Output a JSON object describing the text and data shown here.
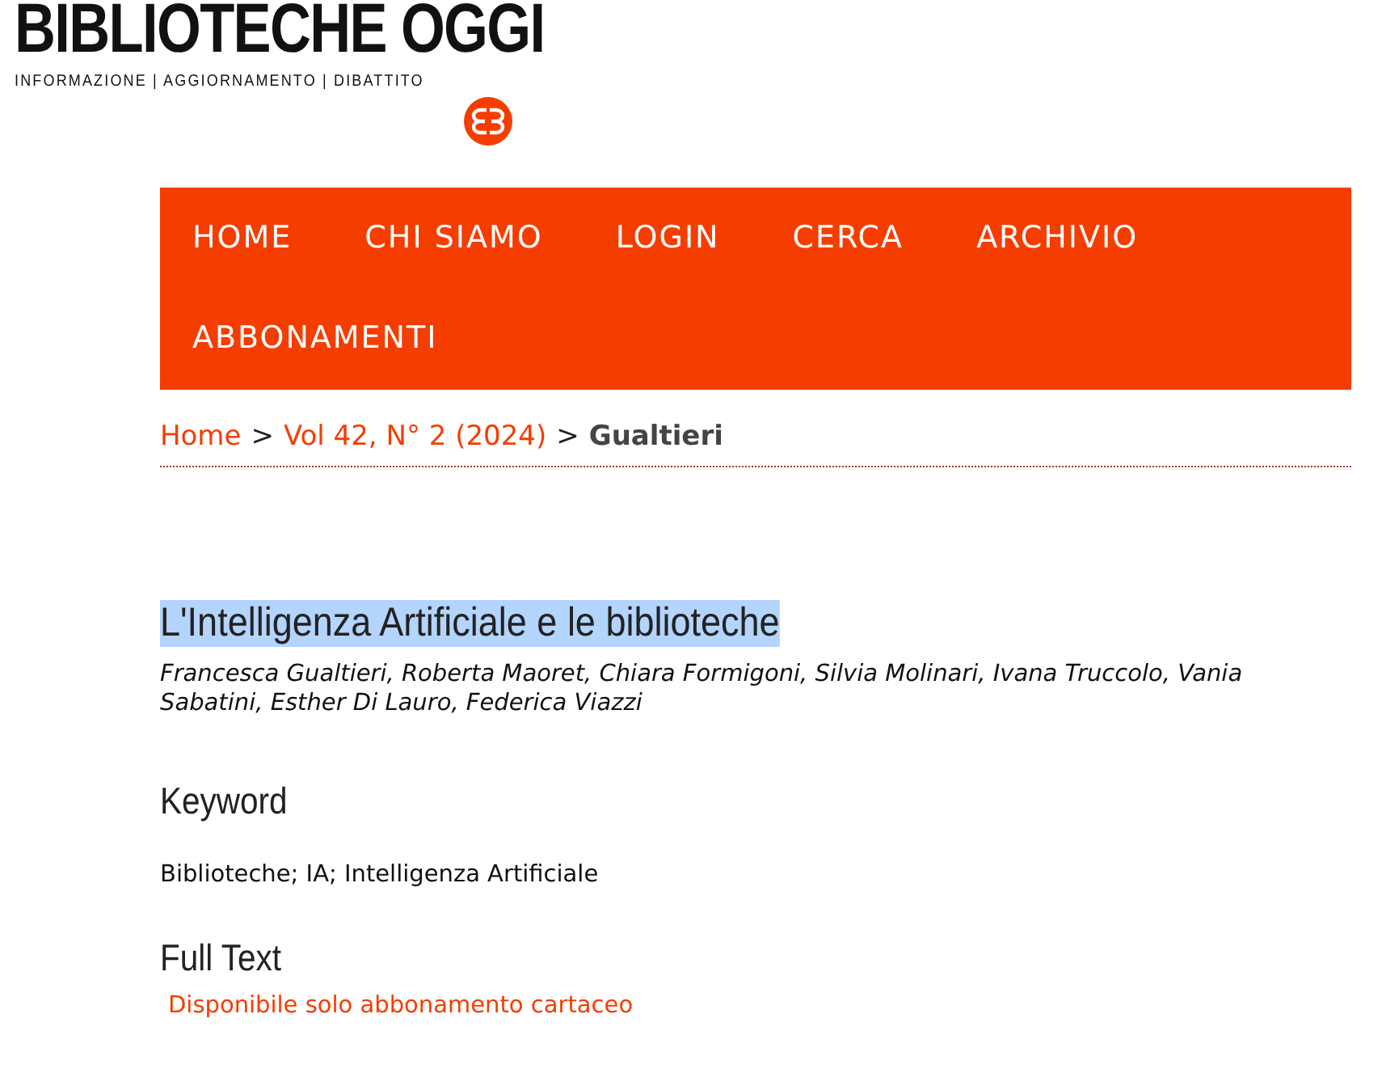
{
  "header": {
    "title": "BIBLIOTECHE OGGI",
    "tagline": "INFORMAZIONE | AGGIORNAMENTO | DIBATTITO"
  },
  "nav": [
    "HOME",
    "CHI SIAMO",
    "LOGIN",
    "CERCA",
    "ARCHIVIO",
    "ABBONAMENTI"
  ],
  "breadcrumb": {
    "links": [
      "Home",
      "Vol 42, N° 2 (2024)"
    ],
    "separator": ">",
    "current": "Gualtieri"
  },
  "article": {
    "title": "L'Intelligenza Artificiale e le biblioteche",
    "title_selected": true,
    "authors": "Francesca Gualtieri, Roberta Maoret, Chiara Formigoni, Silvia Molinari, Ivana Truccolo, Vania Sabatini, Esther Di Lauro, Federica Viazzi",
    "sections": [
      {
        "heading": "Keyword",
        "kind": "text",
        "body": "Biblioteche; IA; Intelligenza Artificiale"
      },
      {
        "heading": "Full Text",
        "kind": "link",
        "body": "Disponibile solo abbonamento cartaceo"
      }
    ]
  }
}
